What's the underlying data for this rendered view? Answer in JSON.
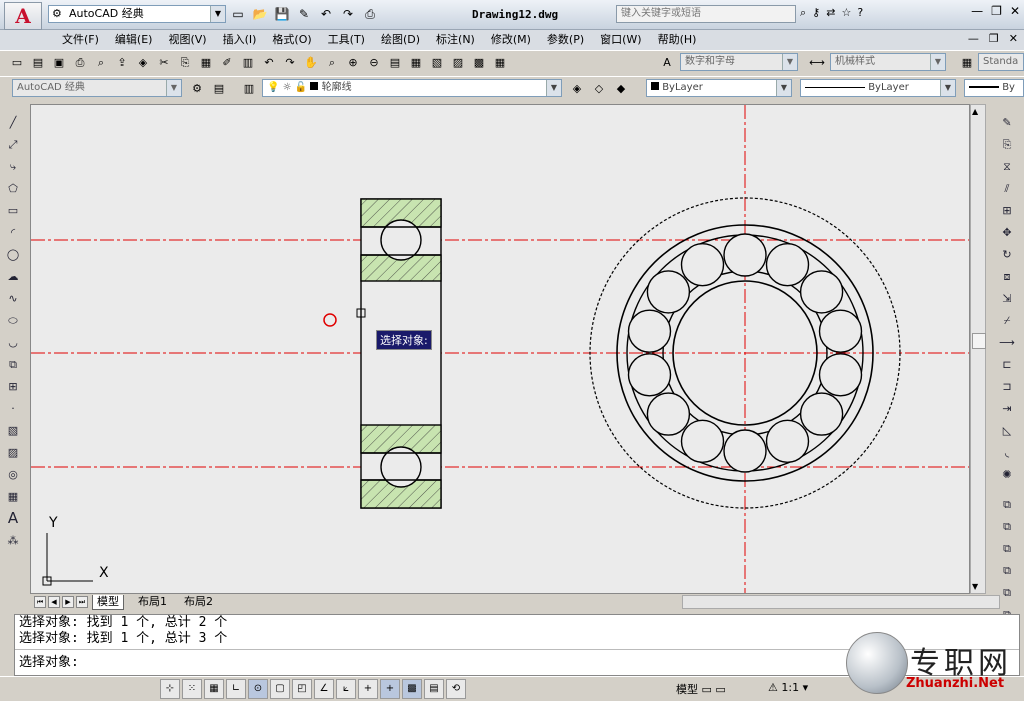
{
  "title_bar": {
    "workspace": "AutoCAD 经典",
    "document_title": "Drawing12.dwg",
    "search_placeholder": "键入关键字或短语"
  },
  "menu": [
    "文件(F)",
    "编辑(E)",
    "视图(V)",
    "插入(I)",
    "格式(O)",
    "工具(T)",
    "绘图(D)",
    "标注(N)",
    "修改(M)",
    "参数(P)",
    "窗口(W)",
    "帮助(H)"
  ],
  "toolbar1": {
    "text_style": "数字和字母",
    "dim_style": "机械样式",
    "table_style": "Standa"
  },
  "toolbar2": {
    "workspace": "AutoCAD 经典",
    "layer": "轮廓线",
    "color": "ByLayer",
    "linetype": "ByLayer",
    "lineweight": "By"
  },
  "canvas": {
    "cursor_tooltip": "选择对象:",
    "ucs_x": "X",
    "ucs_y": "Y"
  },
  "layout_tabs": [
    "模型",
    "布局1",
    "布局2"
  ],
  "command_lines": [
    "选择对象: 找到 1 个, 总计 2 个",
    "选择对象: 找到 1 个, 总计 3 个",
    "选择对象:"
  ],
  "statusbar": {
    "model": "模型",
    "scale": "1:1"
  },
  "watermark": {
    "text": "专职网",
    "url": "Zhuanzhi.Net"
  },
  "colors": {
    "centerline": "#e00000",
    "hatch": "#bfe0a8",
    "pitch_circle": "#c000c0"
  }
}
